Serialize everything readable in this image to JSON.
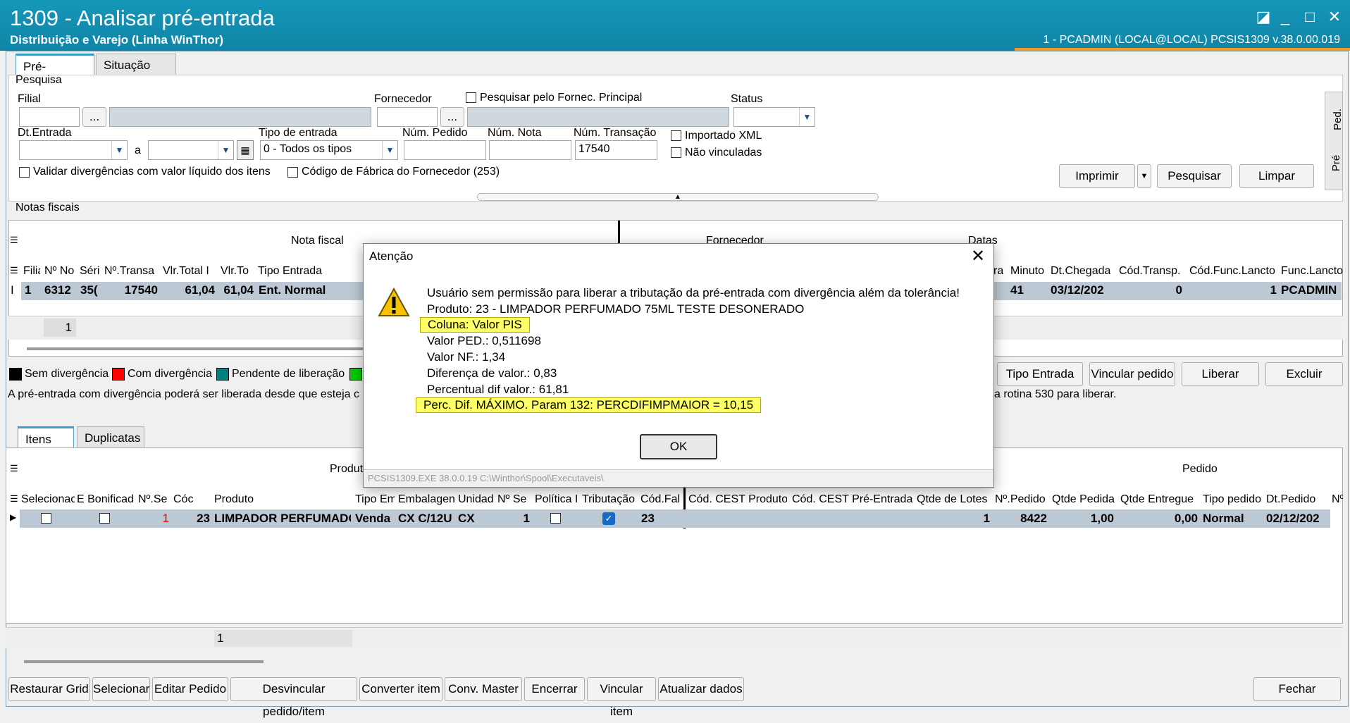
{
  "window": {
    "title": "1309 - Analisar pré-entrada",
    "subtitle": "Distribuição e Varejo (Linha WinThor)",
    "status": "1 - PCADMIN (LOCAL@LOCAL)   PCSIS1309  v.38.0.00.019"
  },
  "tabs": [
    "Pré-Entrada",
    "Situação XML"
  ],
  "search": {
    "section": "Pesquisa",
    "filial": "Filial",
    "fornecedor": "Fornecedor",
    "pesq_principal": "Pesquisar pelo Fornec. Principal",
    "status": "Status",
    "dt_entrada": "Dt.Entrada",
    "a": "a",
    "tipo_entrada": "Tipo de entrada",
    "tipo_value": "0 - Todos os tipos",
    "num_pedido": "Núm. Pedido",
    "num_nota": "Núm. Nota",
    "num_transacao": "Núm. Transação",
    "transacao_value": "17540",
    "importado_xml": "Importado XML",
    "nao_vinculadas": "Não vinculadas",
    "validar": "Validar divergências com valor líquido dos itens",
    "cod_fabrica": "Código de Fábrica do Fornecedor (253)",
    "ellipsis": "...",
    "imprimir": "Imprimir",
    "pesquisar": "Pesquisar",
    "limpar": "Limpar",
    "side_ped": "Ped.",
    "side_pre": "Pré"
  },
  "notas": {
    "section": "Notas fiscais",
    "group_nf": "Nota fiscal",
    "group_forn": "Fornecedor",
    "group_datas": "Datas",
    "cols_left": [
      "Filia",
      "Nº No",
      "Séri",
      "Nº.Transa",
      "Vlr.Total I",
      "Vlr.To",
      "Tipo Entrada"
    ],
    "cols_right": [
      "ra",
      "Minuto",
      "Dt.Chegada",
      "Cód.Transp.",
      "Cód.Func.Lancto",
      "Func.Lancto"
    ],
    "row_left": [
      "1",
      "6312",
      "35(",
      "17540",
      "61,04",
      "61,04",
      "Ent. Normal"
    ],
    "row_right": [
      "",
      "41",
      "03/12/202",
      "0",
      "1",
      "PCADMIN"
    ],
    "row_marker": "I",
    "count": "1"
  },
  "legend": [
    "Sem divergência",
    "Com divergência",
    "Pendente de liberação"
  ],
  "legend_colors": [
    "#000000",
    "#ff0000",
    "#008080",
    "#00cc00"
  ],
  "info_left": "A pré-entrada com divergência poderá ser liberada desde que esteja c",
  "info_right": "a rotina 530 para liberar.",
  "actions": [
    "Tipo Entrada",
    "Vincular pedido",
    "Liberar",
    "Excluir"
  ],
  "item_tabs": [
    "Itens NF",
    "Duplicatas"
  ],
  "itens": {
    "group_produto": "Produt",
    "group_pedido": "Pedido",
    "cols": [
      "Selecionac",
      "E Bonificad",
      "Nº.Se",
      "Cóc",
      "Produto",
      "Tipo Em",
      "Embalagen",
      "Unidad",
      "Nº Se",
      "Política I",
      "Tributação",
      "Cód.Fal",
      "Cód. CEST Produto",
      "Cód. CEST Pré-Entrada",
      "Qtde de Lotes",
      "Nº.Pedido",
      "Qtde Pedida",
      "Qtde Entregue",
      "Tipo pedido",
      "Dt.Pedido",
      "Nº"
    ],
    "row": {
      "seq": "1",
      "cod": "23",
      "produto": "LIMPADOR PERFUMADO",
      "tipo": "Venda",
      "emb": "CX C/12U",
      "unid": "CX",
      "nse": "1",
      "codfab": "23",
      "lotes": "1",
      "pedido": "8422",
      "qtde_pedida": "1,00",
      "qtde_entregue": "0,00",
      "tipo_pedido": "Normal",
      "dt_pedido": "02/12/202"
    },
    "count": "1"
  },
  "bottom": [
    "Restaurar Grid",
    "Selecionar",
    "Editar Pedido",
    "Desvincular pedido/item",
    "Converter item",
    "Conv. Master",
    "Encerrar",
    "Vincular item",
    "Atualizar dados"
  ],
  "fechar": "Fechar",
  "dialog": {
    "title": "Atenção",
    "lines": [
      "Usuário sem permissão para liberar a tributação da pré-entrada com divergência além da tolerância!",
      "Produto: 23 - LIMPADOR PERFUMADO 75ML TESTE DESONERADO",
      "Coluna: Valor PIS",
      "Valor PED.: 0,511698",
      "Valor NF.: 1,34",
      "Diferença de valor.: 0,83",
      "Percentual dif valor.: 61,81",
      "Perc. Dif. MÁXIMO. Param 132: PERCDIFIMPMAIOR = 10,15"
    ],
    "ok": "OK",
    "footer": "PCSIS1309.EXE 38.0.0.19 C:\\Winthor\\Spool\\Executaveis\\"
  }
}
